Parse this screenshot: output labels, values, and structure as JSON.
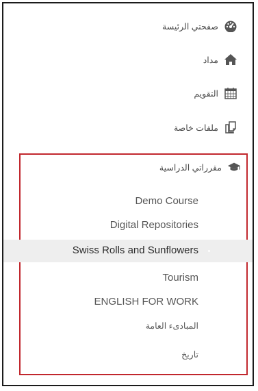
{
  "nav": {
    "dashboard": "صفحتي الرئيسة",
    "home": "مداد",
    "calendar": "التقويم",
    "private_files": "ملفات خاصة",
    "my_courses": "مقرراتي الدراسية"
  },
  "courses": [
    {
      "label": "Demo Course"
    },
    {
      "label": "Digital Repositories"
    },
    {
      "label": "Swiss Rolls and Sunflowers",
      "active": true
    },
    {
      "label": "Tourism"
    },
    {
      "label": "ENGLISH FOR WORK"
    },
    {
      "label": "المبادىء العامة"
    },
    {
      "label": "تاريخ"
    }
  ],
  "colors": {
    "highlight": "#c1272d",
    "active_row": "#eeeeee",
    "text": "#555555"
  },
  "icons": {
    "dashboard": "tachometer-icon",
    "home": "home-icon",
    "calendar": "calendar-icon",
    "private_files": "files-icon",
    "my_courses": "graduation-cap-icon"
  }
}
